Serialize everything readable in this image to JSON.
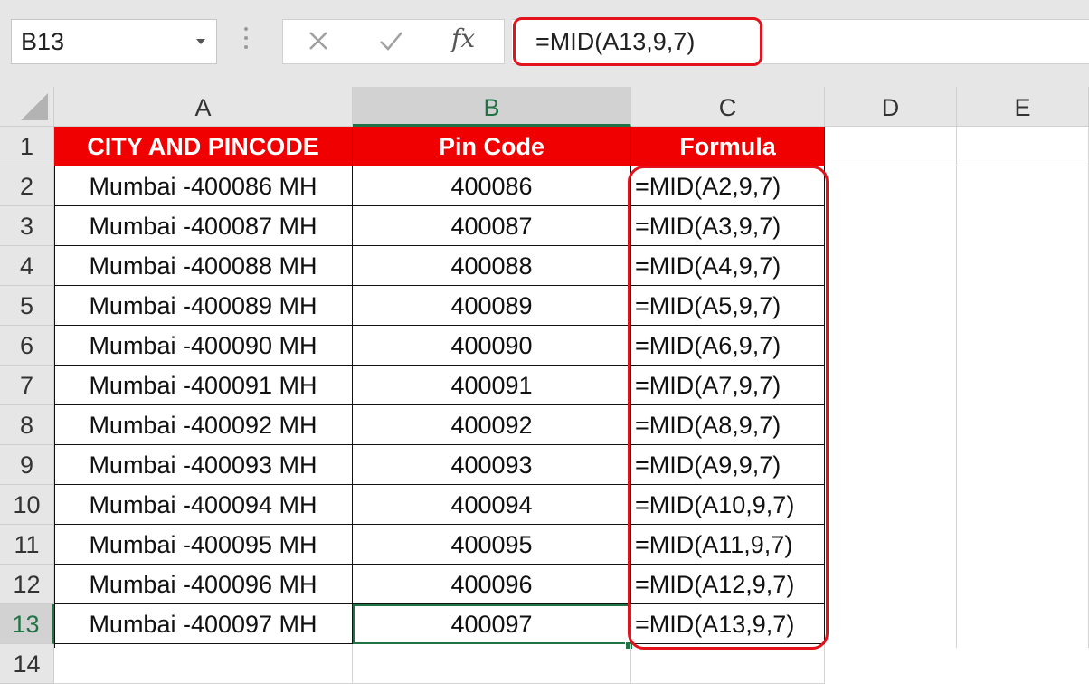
{
  "name_box": {
    "value": "B13"
  },
  "formula_bar": {
    "cancel_icon": "x-icon",
    "enter_icon": "check-icon",
    "fx_label": "fx",
    "value": "=MID(A13,9,7)"
  },
  "columns": [
    "A",
    "B",
    "C",
    "D",
    "E"
  ],
  "selected_column": "B",
  "selected_row": "13",
  "row_numbers": [
    "1",
    "2",
    "3",
    "4",
    "5",
    "6",
    "7",
    "8",
    "9",
    "10",
    "11",
    "12",
    "13",
    "14"
  ],
  "table": {
    "headers": [
      "CITY AND PINCODE",
      "Pin Code",
      "Formula"
    ],
    "header_bg": "#f00000",
    "rows": [
      {
        "city": "Mumbai -400086 MH",
        "pin": "400086",
        "formula": "=MID(A2,9,7)"
      },
      {
        "city": "Mumbai -400087 MH",
        "pin": "400087",
        "formula": "=MID(A3,9,7)"
      },
      {
        "city": "Mumbai -400088 MH",
        "pin": "400088",
        "formula": "=MID(A4,9,7)"
      },
      {
        "city": "Mumbai -400089 MH",
        "pin": "400089",
        "formula": "=MID(A5,9,7)"
      },
      {
        "city": "Mumbai -400090 MH",
        "pin": "400090",
        "formula": "=MID(A6,9,7)"
      },
      {
        "city": "Mumbai -400091 MH",
        "pin": "400091",
        "formula": "=MID(A7,9,7)"
      },
      {
        "city": "Mumbai -400092 MH",
        "pin": "400092",
        "formula": "=MID(A8,9,7)"
      },
      {
        "city": "Mumbai -400093 MH",
        "pin": "400093",
        "formula": "=MID(A9,9,7)"
      },
      {
        "city": "Mumbai -400094 MH",
        "pin": "400094",
        "formula": "=MID(A10,9,7)"
      },
      {
        "city": "Mumbai -400095 MH",
        "pin": "400095",
        "formula": "=MID(A11,9,7)"
      },
      {
        "city": "Mumbai -400096 MH",
        "pin": "400096",
        "formula": "=MID(A12,9,7)"
      },
      {
        "city": "Mumbai -400097 MH",
        "pin": "400097",
        "formula": "=MID(A13,9,7)"
      }
    ]
  },
  "accent_color": "#217346",
  "highlight_color": "#e4121c"
}
